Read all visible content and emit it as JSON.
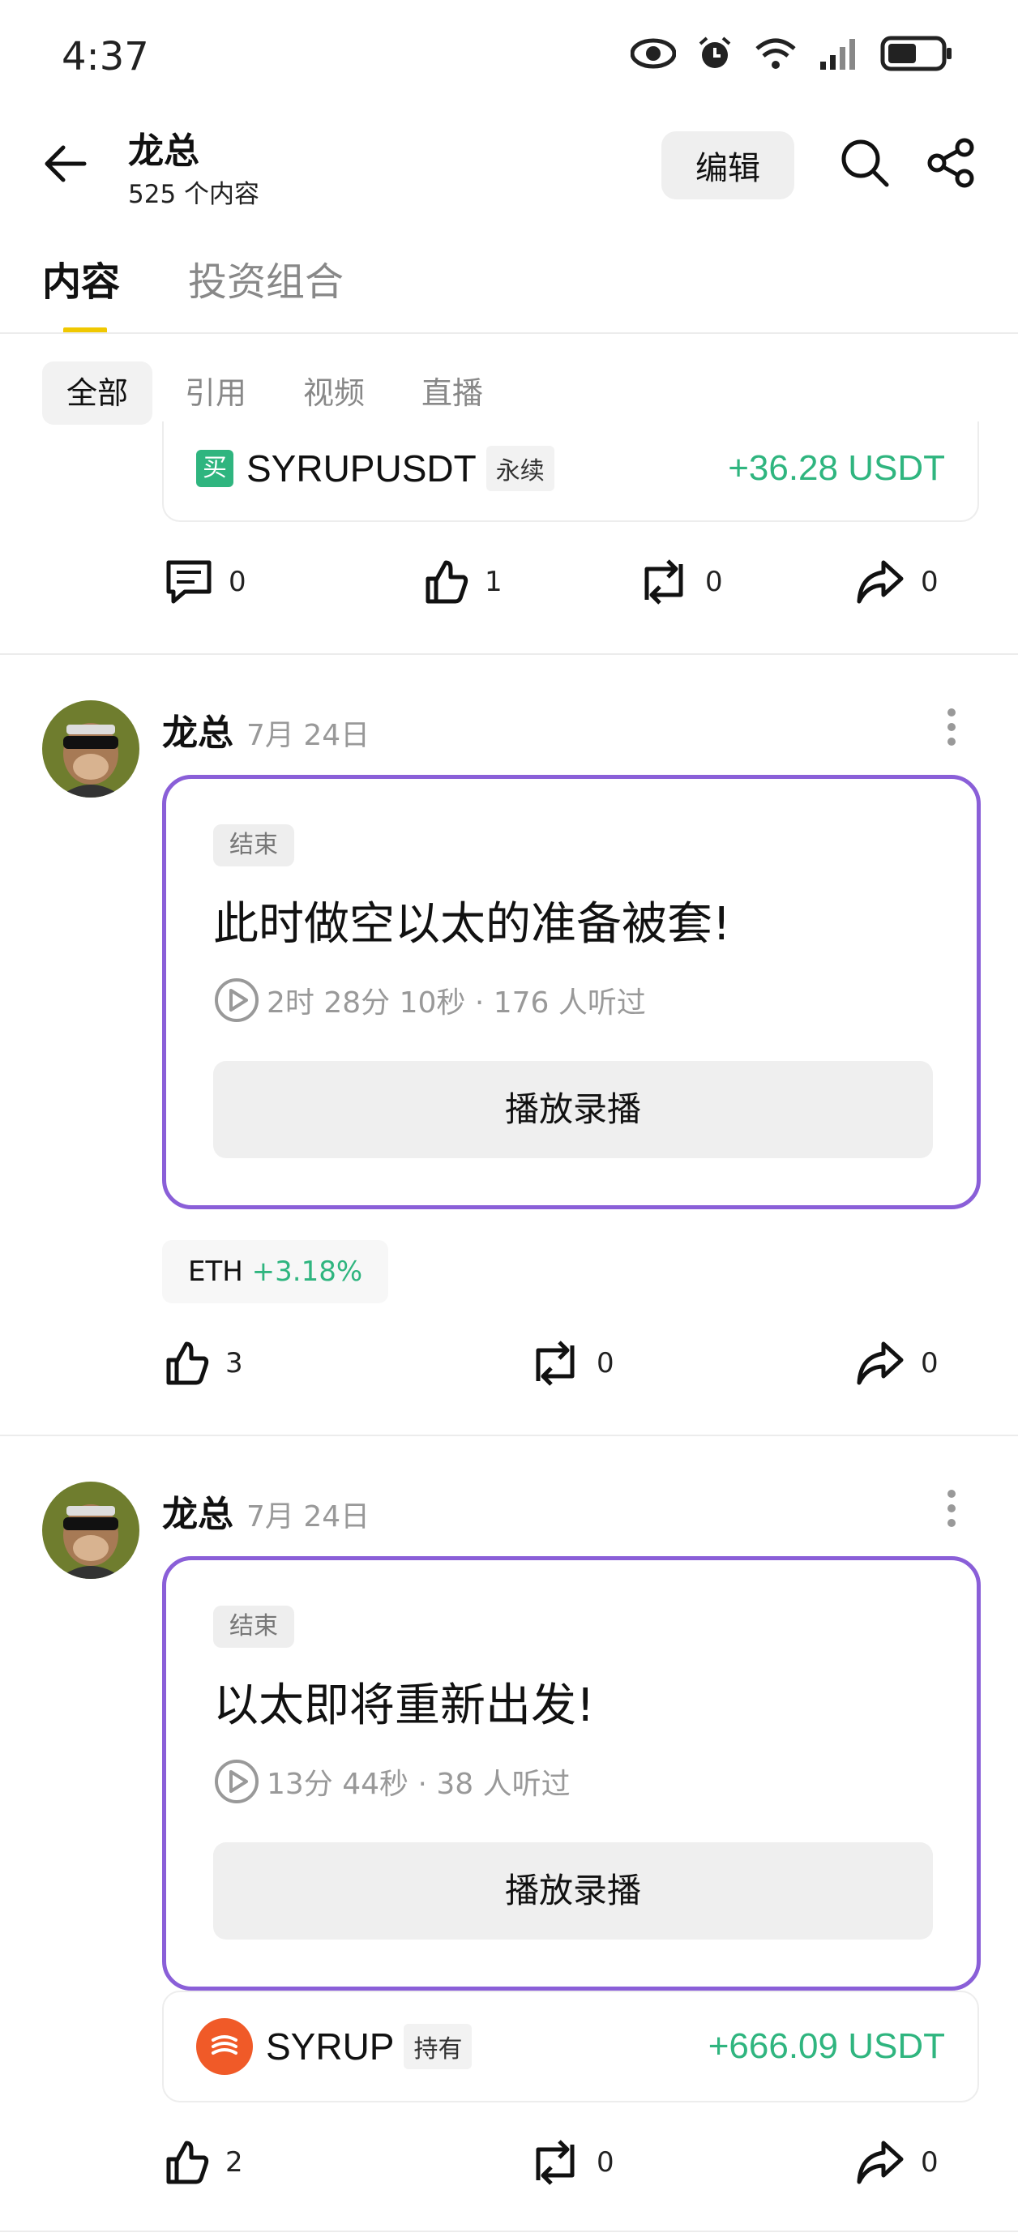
{
  "status": {
    "time": "4:37"
  },
  "header": {
    "title": "龙总",
    "subtitle": "525 个内容",
    "edit_label": "编辑"
  },
  "tabs": [
    "内容",
    "投资组合"
  ],
  "subtabs": [
    "全部",
    "引用",
    "视频",
    "直播"
  ],
  "first_card": {
    "badge": "买",
    "symbol": "SYRUPUSDT",
    "tag": "永续",
    "pnl": "+36.28 USDT",
    "comments": "0",
    "likes": "1",
    "reposts": "0",
    "shares": "0"
  },
  "posts": [
    {
      "author": "龙总",
      "date": "7月 24日",
      "status": "结束",
      "title": "此时做空以太的准备被套!",
      "meta": "2时 28分 10秒 · 176 人听过",
      "play_label": "播放录播",
      "coin": "ETH",
      "coin_change": "+3.18%",
      "likes": "3",
      "reposts": "0",
      "shares": "0"
    },
    {
      "author": "龙总",
      "date": "7月 24日",
      "status": "结束",
      "title": "以太即将重新出发!",
      "meta": "13分 44秒 · 38 人听过",
      "play_label": "播放录播",
      "position_symbol": "SYRUP",
      "position_tag": "持有",
      "position_pnl": "+666.09 USDT",
      "likes": "2",
      "reposts": "0",
      "shares": "0"
    }
  ],
  "colors": {
    "accent": "#f0c800",
    "live_border": "#8a5fd8",
    "positive": "#2fb57f"
  }
}
